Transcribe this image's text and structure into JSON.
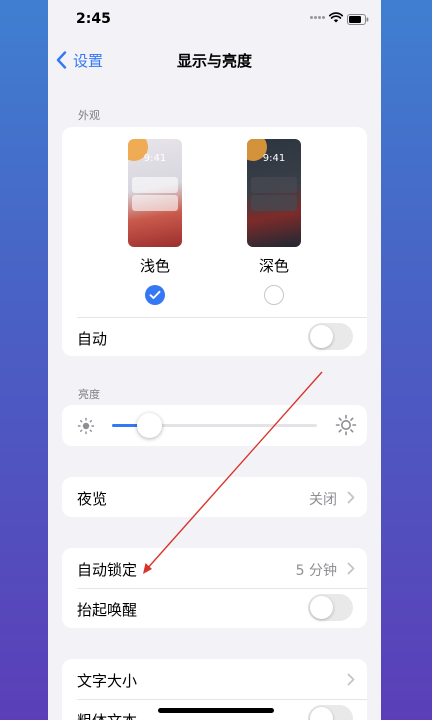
{
  "status_bar": {
    "time": "2:45"
  },
  "nav": {
    "back_label": "设置",
    "title": "显示与亮度"
  },
  "appearance": {
    "section_label": "外观",
    "options": [
      {
        "label": "浅色",
        "preview_time": "9:41",
        "selected": true
      },
      {
        "label": "深色",
        "preview_time": "9:41",
        "selected": false
      }
    ],
    "auto_label": "自动",
    "auto_on": false
  },
  "brightness": {
    "section_label": "亮度",
    "level": 0.18
  },
  "night_shift": {
    "label": "夜览",
    "value": "关闭"
  },
  "lock": {
    "auto_lock_label": "自动锁定",
    "auto_lock_value": "5 分钟",
    "raise_to_wake_label": "抬起唤醒",
    "raise_to_wake_on": false
  },
  "text": {
    "size_label": "文字大小",
    "bold_label": "粗体文本",
    "bold_on": false
  },
  "colors": {
    "accent": "#3478f6",
    "annotation": "#d9342b"
  }
}
